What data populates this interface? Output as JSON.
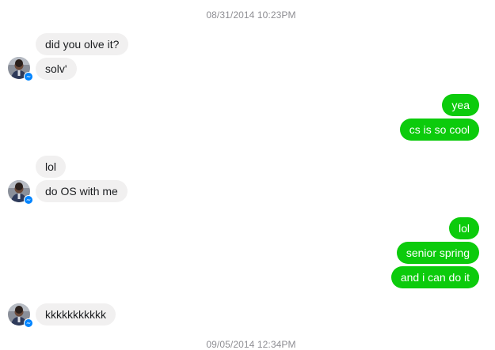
{
  "timestamps": [
    "08/31/2014 10:23PM",
    "09/05/2014 12:34PM"
  ],
  "groups": [
    {
      "side": "incoming",
      "messages": [
        "did you olve it?",
        "solv'"
      ]
    },
    {
      "side": "outgoing",
      "messages": [
        "yea",
        "cs is so cool"
      ]
    },
    {
      "side": "incoming",
      "messages": [
        "lol",
        "do OS with me"
      ]
    },
    {
      "side": "outgoing",
      "messages": [
        "lol",
        "senior spring",
        "and i can do it"
      ]
    },
    {
      "side": "incoming",
      "messages": [
        "kkkkkkkkkkk"
      ]
    }
  ],
  "colors": {
    "incoming_bubble": "#f1f0f0",
    "outgoing_bubble": "#0ccb0c",
    "messenger_badge": "#0084ff",
    "timestamp_text": "#8e8e93"
  },
  "icons": {
    "avatar": "contact-avatar",
    "badge": "messenger-badge-icon"
  }
}
